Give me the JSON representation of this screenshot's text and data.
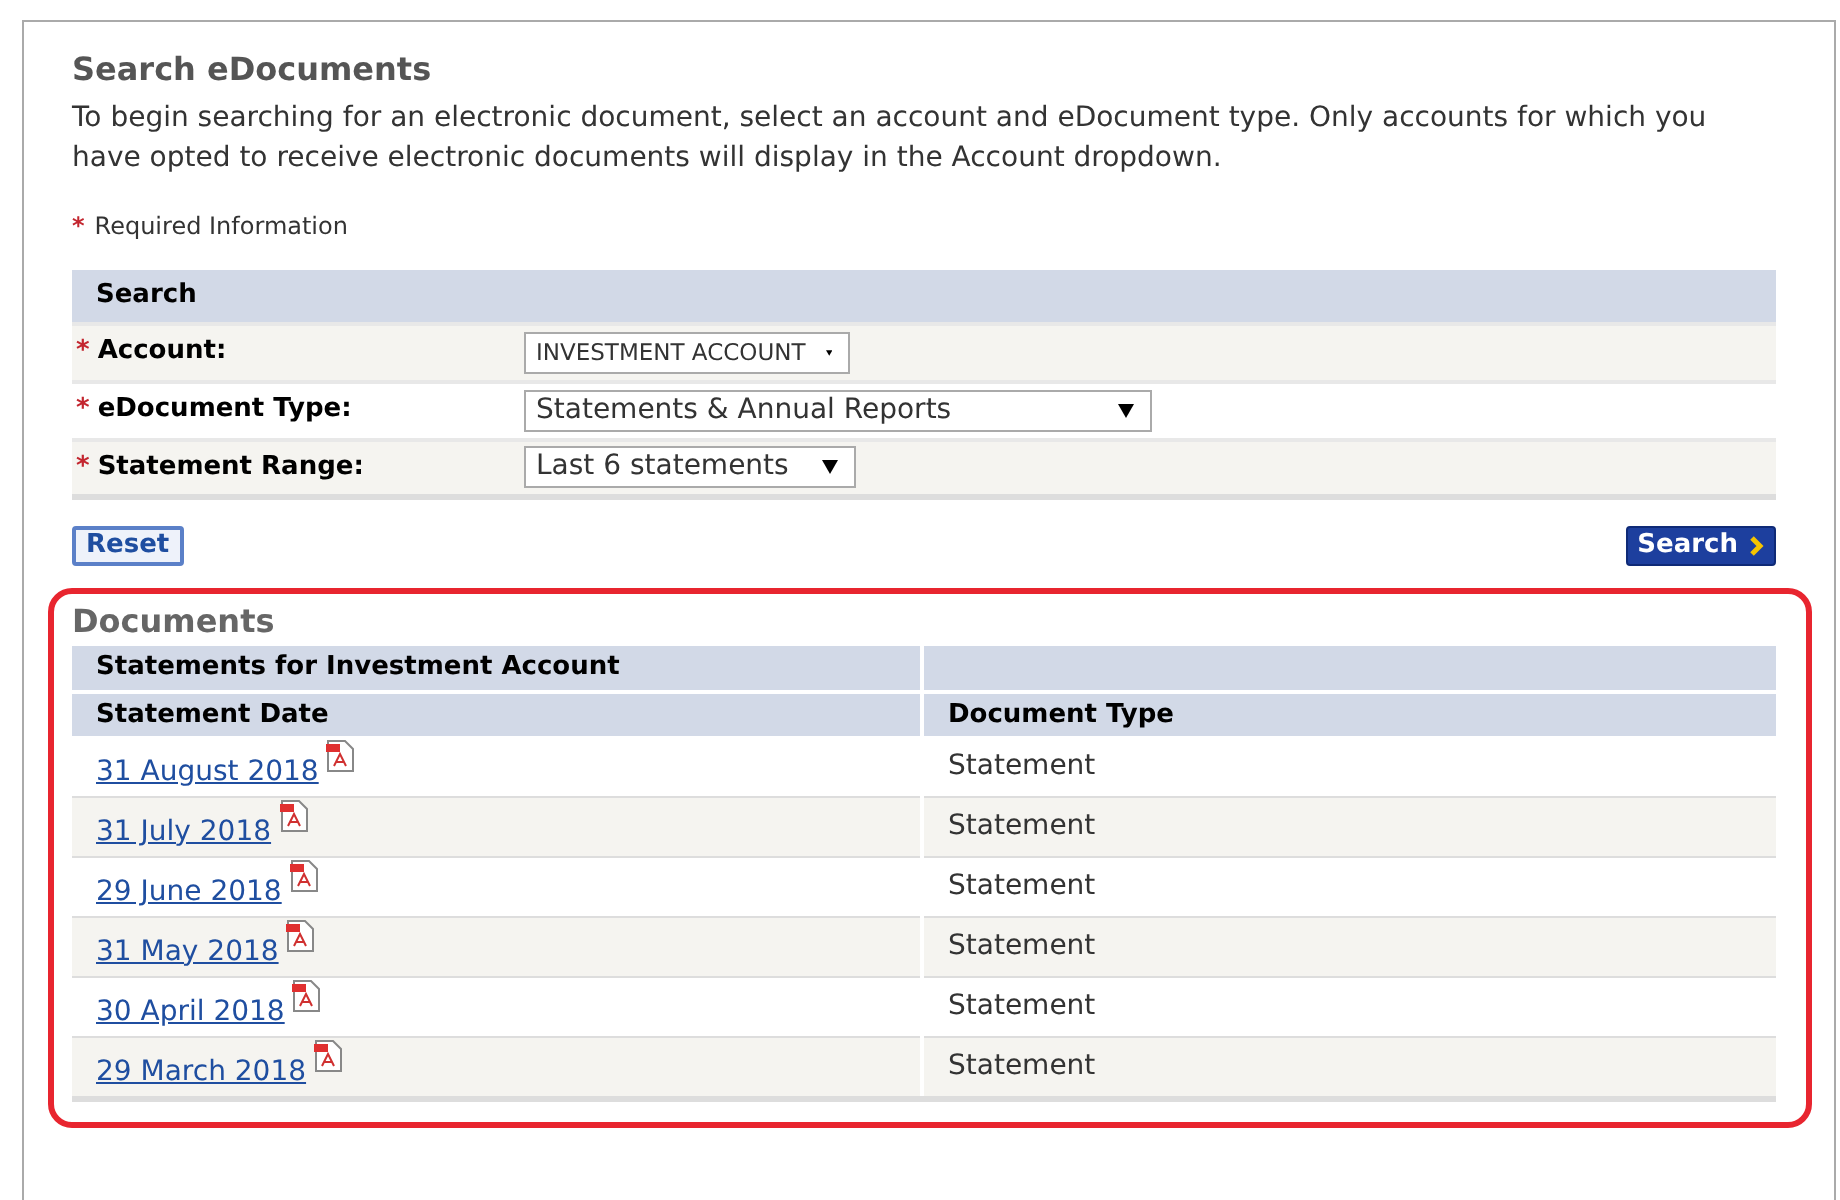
{
  "title": "Search eDocuments",
  "intro": "To begin searching for an electronic document, select an account and eDocument type. Only accounts for which you have opted to receive electronic documents will display in the Account dropdown.",
  "required_note": {
    "marker": "*",
    "text": "Required Information"
  },
  "search_form": {
    "heading": "Search",
    "fields": [
      {
        "marker": "*",
        "label": "Account:",
        "value": "INVESTMENT ACCOUNT"
      },
      {
        "marker": "*",
        "label": "eDocument Type:",
        "value": "Statements & Annual Reports"
      },
      {
        "marker": "*",
        "label": "Statement Range:",
        "value": "Last 6 statements"
      }
    ]
  },
  "buttons": {
    "reset": "Reset",
    "search": "Search"
  },
  "documents": {
    "heading": "Documents",
    "caption": "Statements for Investment Account",
    "columns": [
      "Statement Date",
      "Document Type"
    ],
    "rows": [
      {
        "date": "31 August 2018",
        "type": "Statement"
      },
      {
        "date": "31 July 2018",
        "type": "Statement"
      },
      {
        "date": "29 June 2018",
        "type": "Statement"
      },
      {
        "date": "31 May 2018",
        "type": "Statement"
      },
      {
        "date": "30 April 2018",
        "type": "Statement"
      },
      {
        "date": "29 March 2018",
        "type": "Statement"
      }
    ]
  }
}
